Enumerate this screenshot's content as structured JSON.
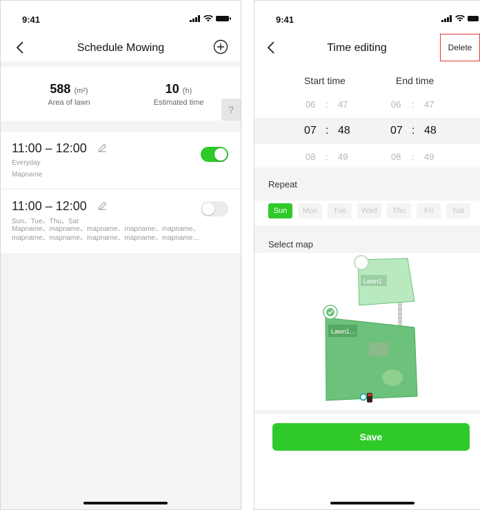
{
  "left": {
    "status": {
      "time": "9:41"
    },
    "nav": {
      "title": "Schedule Mowing"
    },
    "summary": {
      "area_value": "588",
      "area_unit": "(m²)",
      "area_label": "Area of lawn",
      "time_value": "10",
      "time_unit": "(h)",
      "time_label": "Estimated time",
      "help": "?"
    },
    "schedules": [
      {
        "time": "11:00 – 12:00",
        "days": "Everyday",
        "maps": "Mapname",
        "enabled": true
      },
      {
        "time": "11:00 – 12:00",
        "days": "Sun、Tue、Thu、Sat",
        "maps": "Mapname、mapname、mapname、mapname、mapname、mapname、mapname、mapname、mapname、mapname…",
        "enabled": false
      }
    ]
  },
  "right": {
    "status": {
      "time": "9:41"
    },
    "nav": {
      "title": "Time editing",
      "delete": "Delete"
    },
    "picker": {
      "start_header": "Start time",
      "end_header": "End time",
      "separator": ":",
      "rows": [
        {
          "sh": "06",
          "sm": "47",
          "eh": "06",
          "em": "47"
        },
        {
          "sh": "07",
          "sm": "48",
          "eh": "07",
          "em": "48"
        },
        {
          "sh": "08",
          "sm": "49",
          "eh": "08",
          "em": "49"
        }
      ]
    },
    "repeat": {
      "label": "Repeat",
      "days": [
        "Sun",
        "Mon",
        "Tue",
        "Wed",
        "Thu",
        "Fri",
        "Sat"
      ],
      "selected": "Sun"
    },
    "map": {
      "label": "Select map",
      "lawns": [
        {
          "name": "Lawn1",
          "selected": false
        },
        {
          "name": "Lawn1...",
          "selected": true
        }
      ]
    },
    "save": "Save"
  },
  "colors": {
    "accent": "#2fc92a",
    "delete_border": "#e53935",
    "lawn_light": "#b9e9bf",
    "lawn_dark": "#6cc27a"
  }
}
